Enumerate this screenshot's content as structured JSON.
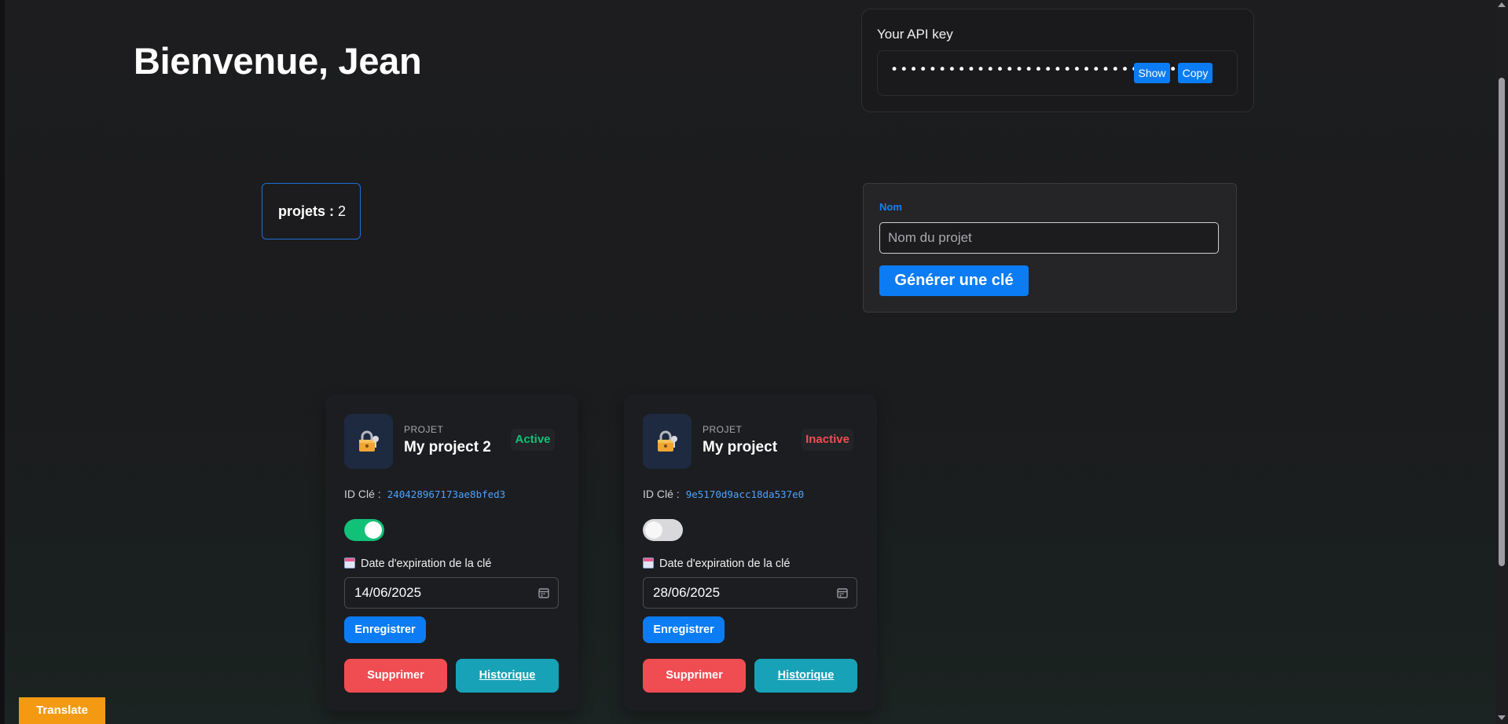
{
  "welcome": "Bienvenue, Jean",
  "api": {
    "title": "Your API key",
    "masked_key": "••••••••••••••••••••••••••••••",
    "show_label": "Show",
    "copy_label": "Copy"
  },
  "stats": {
    "projects_label": "projets :",
    "projects_count": "2"
  },
  "form": {
    "label": "Nom",
    "placeholder": "Nom du projet",
    "submit_label": "Générer une clé"
  },
  "projects": [
    {
      "kicker": "PROJET",
      "name": "My project 2",
      "status": "Active",
      "status_color": "#12c178",
      "id_label": "ID Clé :",
      "key_id": "240428967173ae8bfed3",
      "enabled": true,
      "expiry_label": "Date d'expiration de la clé",
      "expiry_date": "14/06/2025",
      "save_label": "Enregistrer",
      "delete_label": "Supprimer",
      "history_label": "Historique"
    },
    {
      "kicker": "PROJET",
      "name": "My project",
      "status": "Inactive",
      "status_color": "#f04d52",
      "id_label": "ID Clé :",
      "key_id": "9e5170d9acc18da537e0",
      "enabled": false,
      "expiry_label": "Date d'expiration de la clé",
      "expiry_date": "28/06/2025",
      "save_label": "Enregistrer",
      "delete_label": "Supprimer",
      "history_label": "Historique"
    }
  ],
  "translate_label": "Translate",
  "colors": {
    "accent": "#0b7cf3",
    "active": "#12c178",
    "danger": "#f04d52",
    "info": "#17a2b8",
    "warning": "#f39a12"
  },
  "icons": {
    "project": "lock-key-icon",
    "calendar": "calendar-icon",
    "date_picker": "calendar-picker-icon"
  }
}
